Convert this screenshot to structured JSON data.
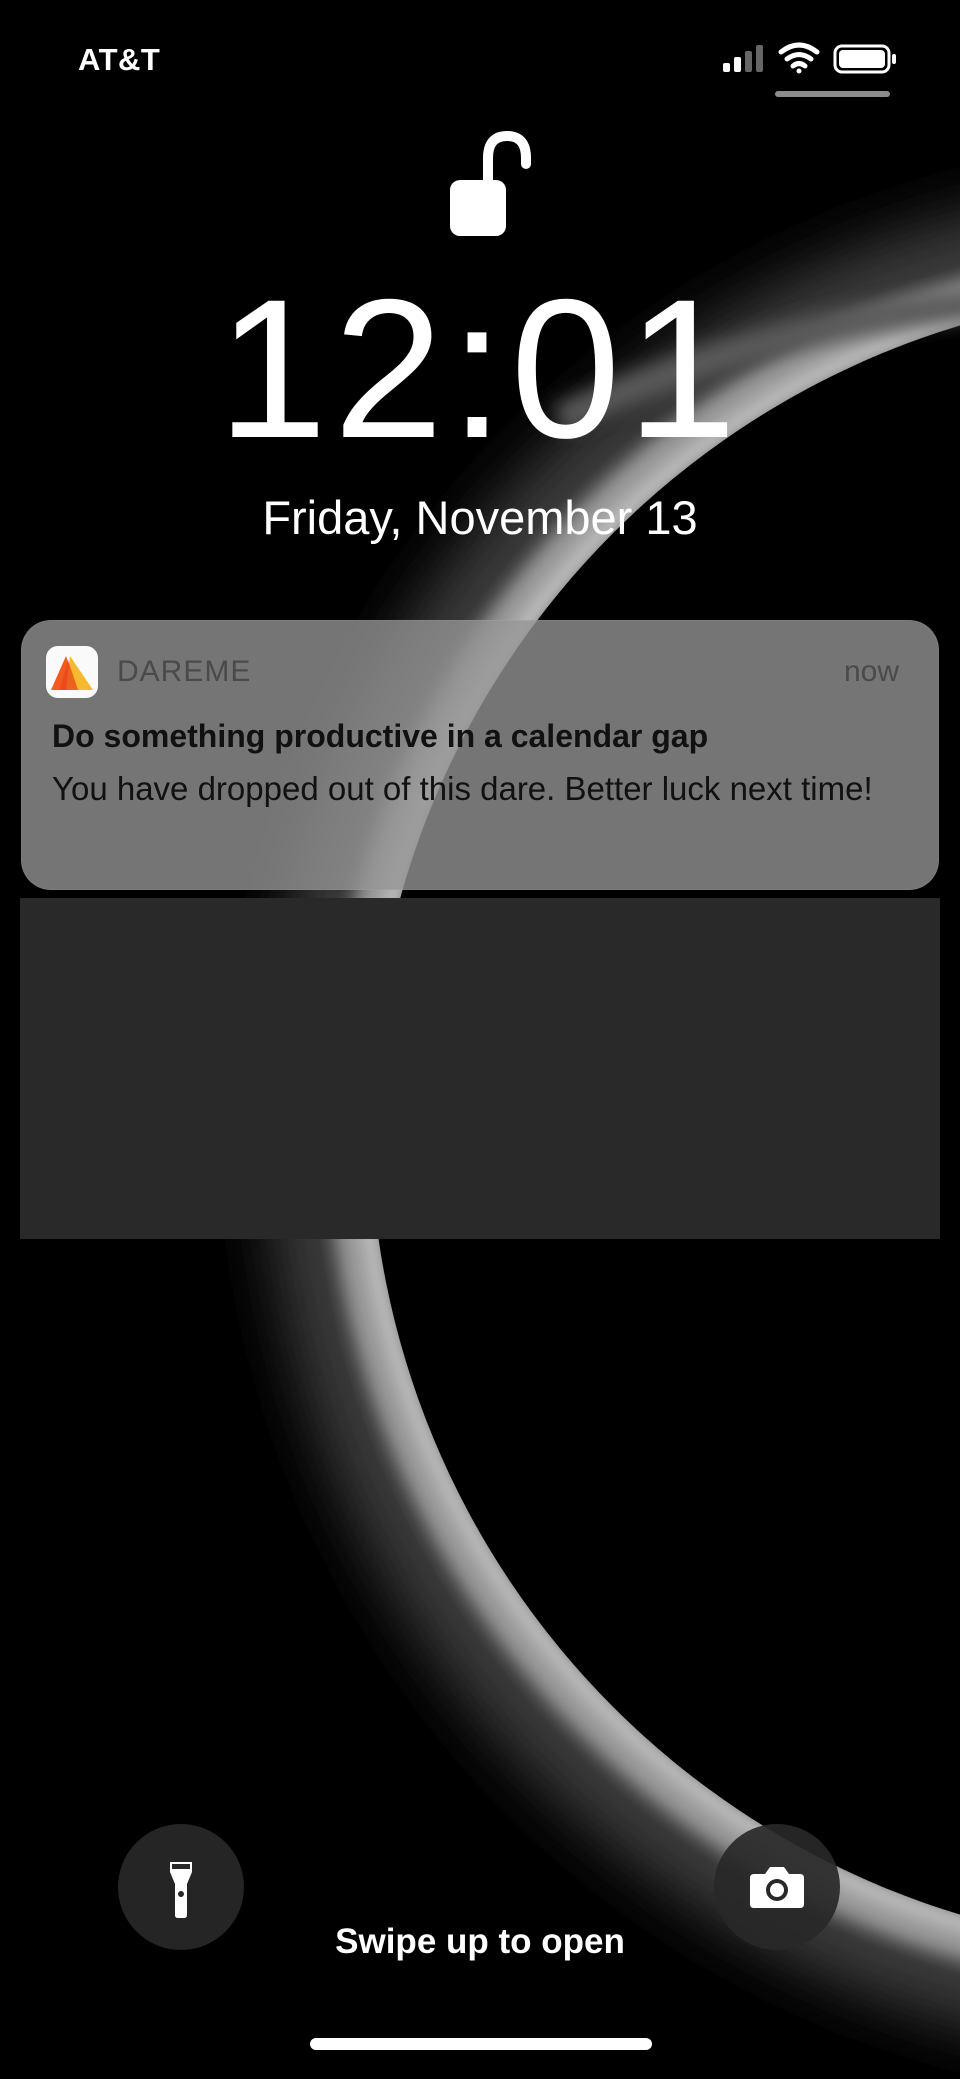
{
  "status_bar": {
    "carrier": "AT&T",
    "signal_icon": "cellular-signal-icon",
    "wifi_icon": "wifi-icon",
    "battery_icon": "battery-icon"
  },
  "lock_screen": {
    "lock_icon": "unlocked-padlock-icon",
    "time": "12:01",
    "date": "Friday, November 13"
  },
  "notification": {
    "app_icon": "dareme-app-icon",
    "app_name": "DAREME",
    "timestamp": "now",
    "title": "Do something productive in a calendar gap",
    "body": "You have dropped out of this dare. Better luck next time!"
  },
  "quick_actions": {
    "flashlight_icon": "flashlight-icon",
    "camera_icon": "camera-icon"
  },
  "swipe_hint": "Swipe up to open",
  "colors": {
    "notification_bg": "#969696",
    "overlay_panel": "#292929",
    "app_icon_orange": "#f25a1f",
    "app_icon_yellow": "#f7b21e"
  }
}
